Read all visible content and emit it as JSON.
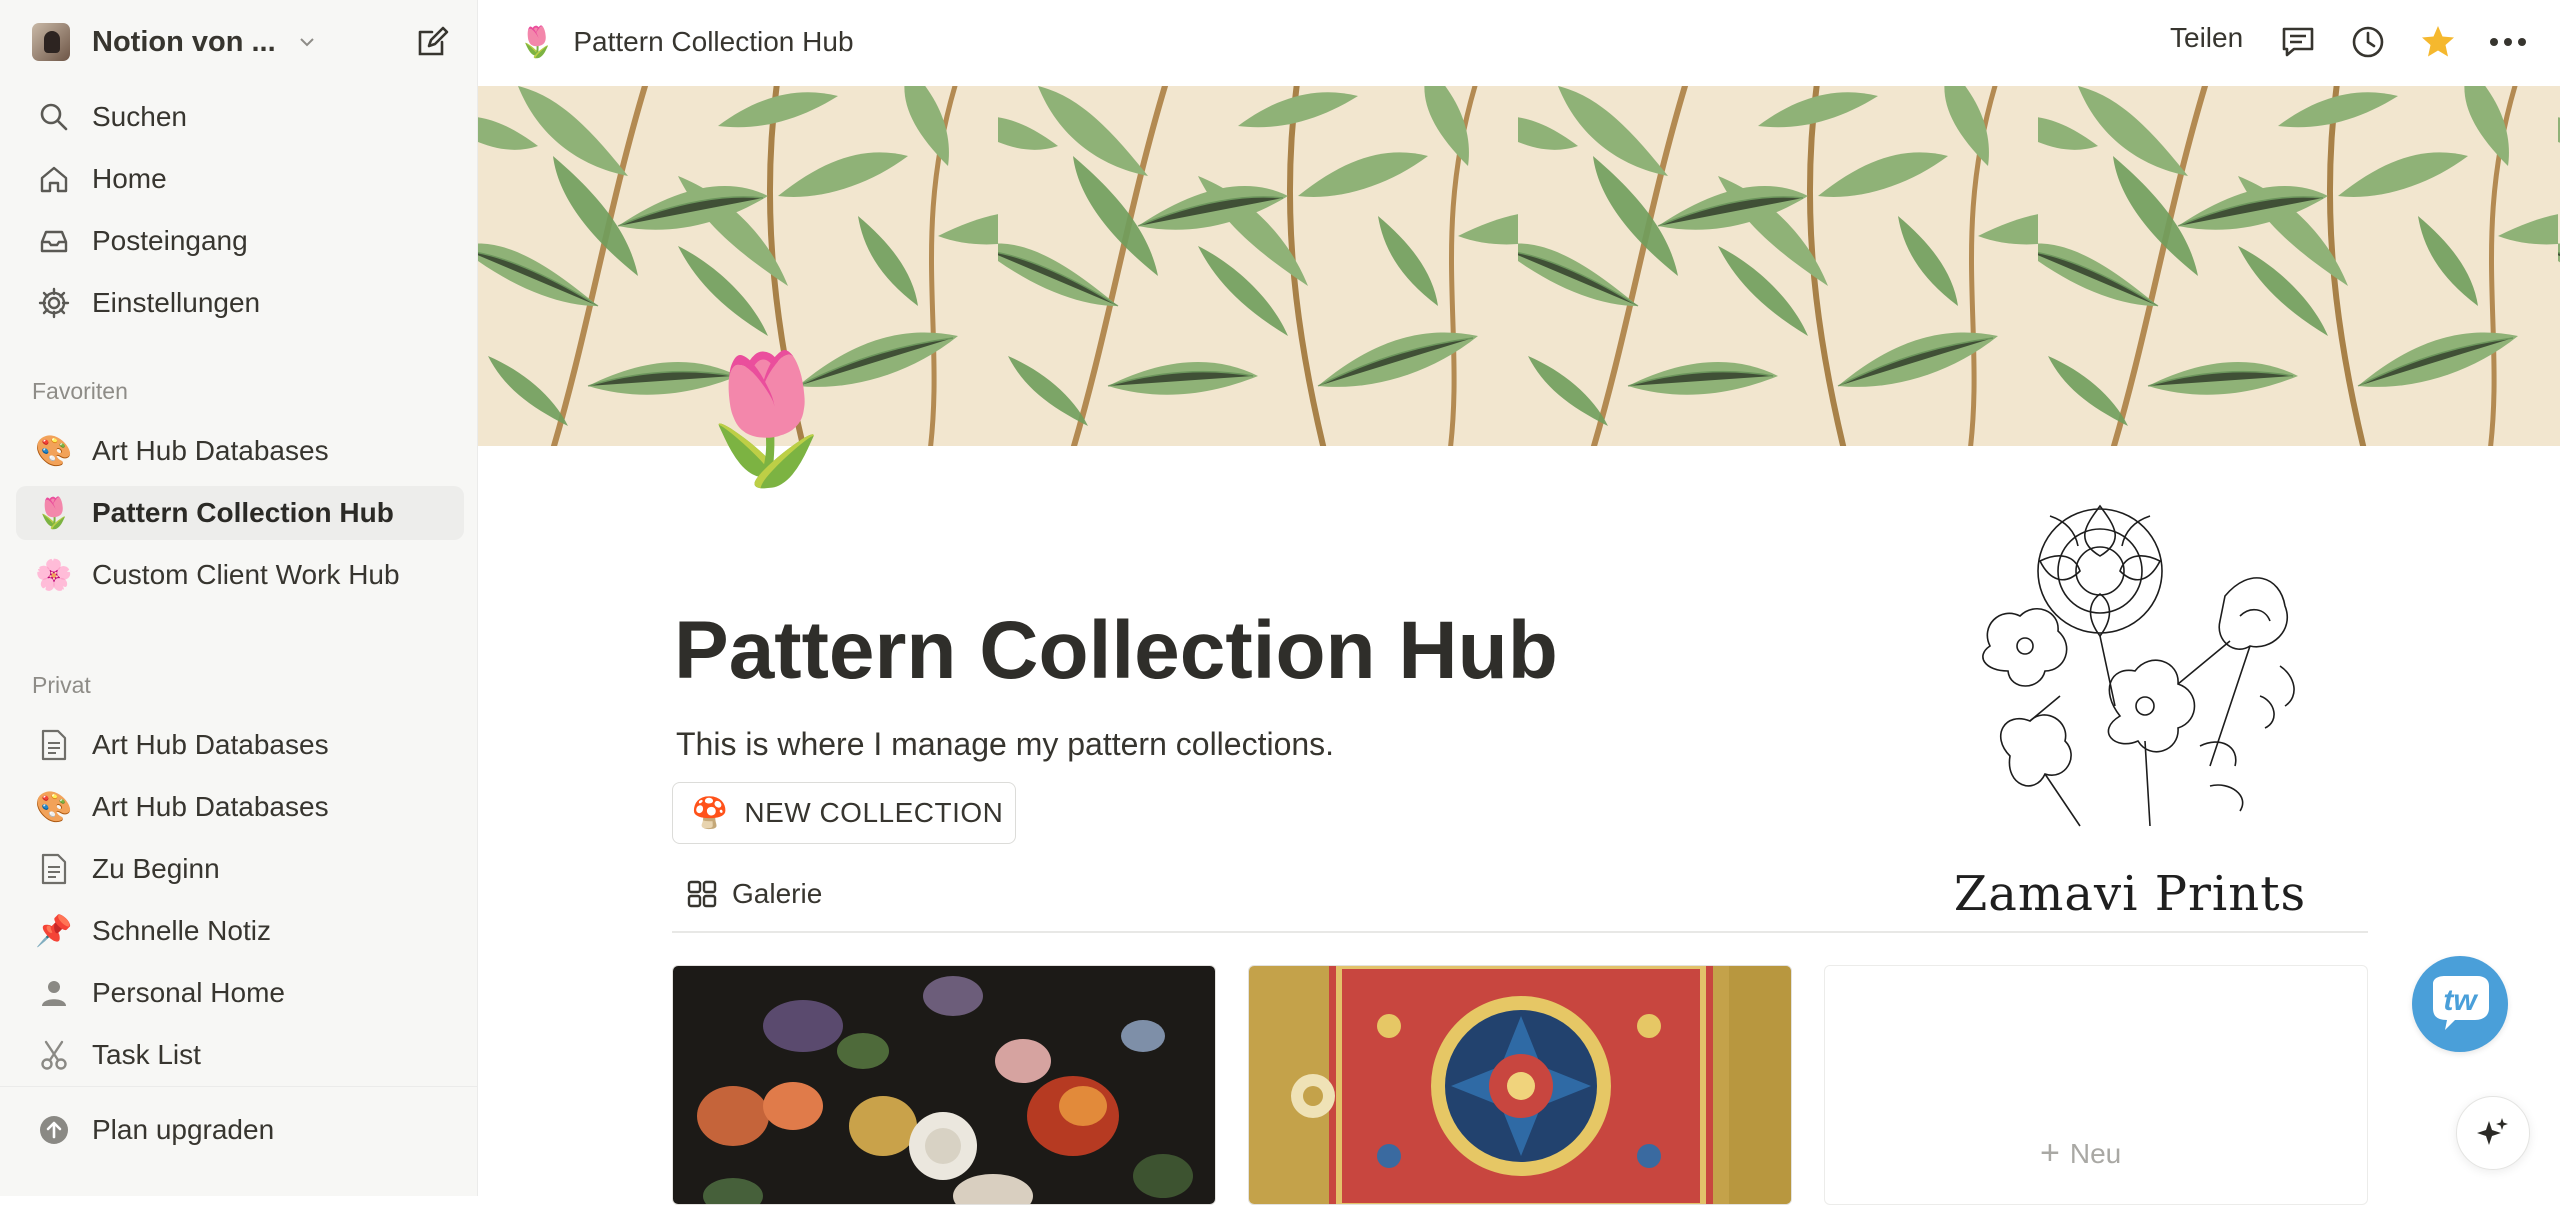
{
  "workspace": {
    "name": "Notion von ..."
  },
  "nav": {
    "search": "Suchen",
    "home": "Home",
    "inbox": "Posteingang",
    "settings": "Einstellungen"
  },
  "favorites": {
    "label": "Favoriten",
    "items": [
      {
        "icon": "🎨",
        "label": "Art Hub Databases"
      },
      {
        "icon": "🌷",
        "label": "Pattern Collection Hub"
      },
      {
        "icon": "🌸",
        "label": "Custom Client Work Hub"
      }
    ]
  },
  "private": {
    "label": "Privat",
    "items": [
      {
        "icon": "page-icon",
        "label": "Art Hub Databases"
      },
      {
        "icon": "🎨",
        "label": "Art Hub Databases"
      },
      {
        "icon": "page-icon",
        "label": "Zu Beginn"
      },
      {
        "icon": "📌",
        "label": "Schnelle Notiz"
      },
      {
        "icon": "person-icon",
        "label": "Personal Home"
      },
      {
        "icon": "scissors-icon",
        "label": "Task List"
      }
    ]
  },
  "upgrade": {
    "label": "Plan upgraden"
  },
  "topbar": {
    "breadcrumb_icon": "🌷",
    "breadcrumb": "Pattern Collection Hub",
    "share": "Teilen"
  },
  "page": {
    "icon": "🌷",
    "title": "Pattern Collection Hub",
    "description": "This is where I manage my pattern collections.",
    "button_icon": "🍄",
    "button": "NEW COLLECTION",
    "brand": "Zamavi Prints",
    "view_tab": "Galerie",
    "new_card": "Neu"
  },
  "fab": {
    "label": "tw"
  },
  "colors": {
    "accent_star": "#f5b82e",
    "fab": "#4a9fd9",
    "sidebar_bg": "#f7f7f5"
  }
}
